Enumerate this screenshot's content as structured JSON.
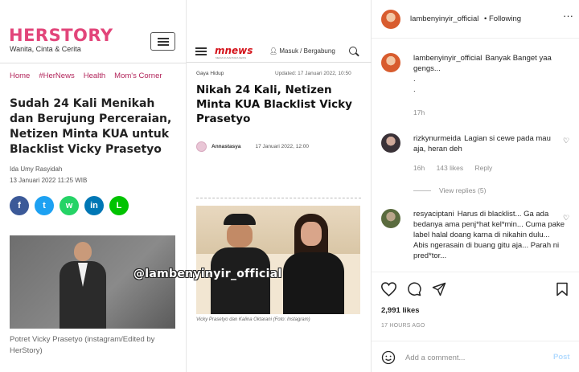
{
  "herstory": {
    "logo": "HERSTORY",
    "tagline": "Wanita, Cinta & Cerita",
    "nav": [
      "Home",
      "#HerNews",
      "Health",
      "Mom's Corner"
    ],
    "headline": "Sudah 24 Kali Menikah dan Berujung Perceraian, Netizen Minta KUA untuk Blacklist Vicky Prasetyo",
    "author": "Ida Umy Rasyidah",
    "date": "13 Januari 2022 11:25 WIB",
    "share_icons": [
      {
        "name": "facebook-icon",
        "glyph": "f",
        "color": "#3b5998"
      },
      {
        "name": "twitter-icon",
        "glyph": "t",
        "color": "#1da1f2"
      },
      {
        "name": "whatsapp-icon",
        "glyph": "w",
        "color": "#25d366"
      },
      {
        "name": "linkedin-icon",
        "glyph": "in",
        "color": "#0077b5"
      },
      {
        "name": "line-icon",
        "glyph": "L",
        "color": "#00c300"
      }
    ],
    "caption": "Potret Vicky Prasetyo (instagram/Edited by HerStory)",
    "accent": "#e2457a"
  },
  "mnews": {
    "logo": "mnews",
    "logo_sub": "MEDIA NUSANTARA NEWS",
    "user_link": "Masuk / Bergabung",
    "category": "Gaya Hidup",
    "updated": "Updated: 17 Januari 2022, 10:50",
    "headline": "Nikah 24 Kali, Netizen Minta KUA Blacklist Vicky Prasetyo",
    "author": "Annastasya",
    "date": "17 Januari 2022, 12:00",
    "photo_caption": "Vicky Prasetyo dan Kalina Oktarani (Foto: Instagram)"
  },
  "watermark": "@lambenyinyir_official",
  "instagram": {
    "account": "lambenyinyir_official",
    "following_label": "• Following",
    "more_glyph": "···",
    "comments": [
      {
        "user": "lambenyinyir_official",
        "text": "Banyak Banget yaa gengs...",
        "extra": [
          ".",
          "."
        ],
        "time": "17h",
        "likes": "",
        "reply": "",
        "avatar": "orange"
      },
      {
        "user": "rizkynurmeida",
        "text": "Lagian si cewe pada mau aja, heran deh",
        "time": "16h",
        "likes": "143 likes",
        "reply": "Reply",
        "avatar": "dark"
      },
      {
        "user": "resyaciptani",
        "text": "Harus di blacklist... Ga ada bedanya ama penj*hat kel*min... Cuma pake label halal doang karna di nikahin dulu... Abis ngerasain di buang gitu aja... Parah ni pred*tor...",
        "time": "",
        "likes": "",
        "reply": "",
        "avatar": "green"
      }
    ],
    "view_replies": "View replies (5)",
    "likes": "2,991 likes",
    "time_ago": "17 HOURS AGO",
    "add_comment_placeholder": "Add a comment...",
    "post_label": "Post"
  }
}
